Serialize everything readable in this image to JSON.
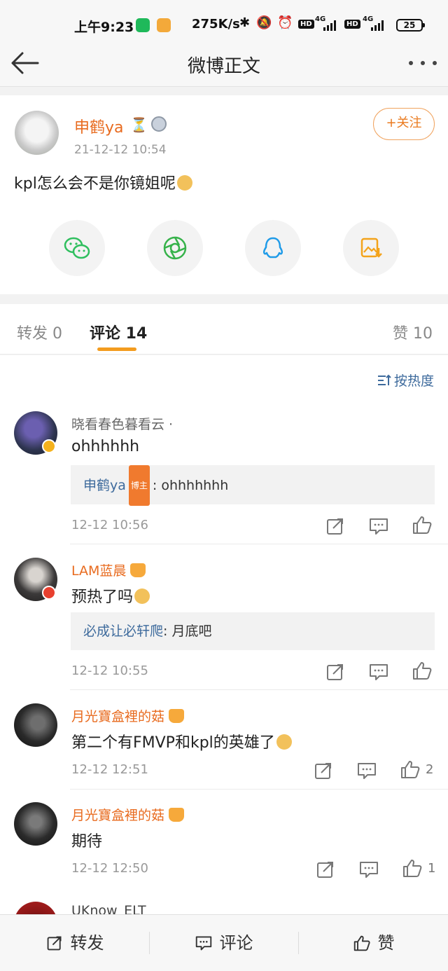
{
  "status_bar": {
    "time": "上午9:23",
    "speed": "275K/s",
    "hd1": "HD",
    "net1": "4G",
    "hd2": "HD",
    "net2": "4G",
    "battery": "25"
  },
  "nav": {
    "title": "微博正文"
  },
  "post": {
    "author": "申鹤ya",
    "time": "21-12-12 10:54",
    "follow_label": "+关注",
    "text": "kpl怎么会不是你镜姐呢",
    "share_targets": [
      "wechat-icon",
      "moments-icon",
      "qq-icon",
      "save-image-icon"
    ]
  },
  "tabs": {
    "repost": "转发 0",
    "comment": "评论 14",
    "like": "赞 10"
  },
  "sort_label": "按热度",
  "comments": [
    {
      "name": "晓看春色暮看云 ·",
      "text": "ohhhhhh",
      "reply_user": "申鹤ya",
      "reply_tag": "博主",
      "reply_text": ": ohhhhhhh",
      "time": "12-12 10:56",
      "likes": ""
    },
    {
      "name": "LAM蓝晨",
      "text": "预热了吗",
      "reply_user": "必成让必轩爬",
      "reply_tag": "",
      "reply_text": ": 月底吧",
      "time": "12-12 10:55",
      "likes": ""
    },
    {
      "name": "月光寶盒裡的菇",
      "text": "第二个有FMVP和kpl的英雄了",
      "time": "12-12 12:51",
      "likes": "2"
    },
    {
      "name": "月光寶盒裡的菇",
      "text": "期待",
      "time": "12-12 12:50",
      "likes": "1"
    },
    {
      "name": "UKnow_ELT"
    }
  ],
  "bottom_bar": {
    "repost": "转发",
    "comment": "评论",
    "like": "赞"
  },
  "colors": {
    "accent_orange": "#e86b1f",
    "link_blue": "#3d6a9c",
    "tab_indicator": "#f39c1f"
  }
}
